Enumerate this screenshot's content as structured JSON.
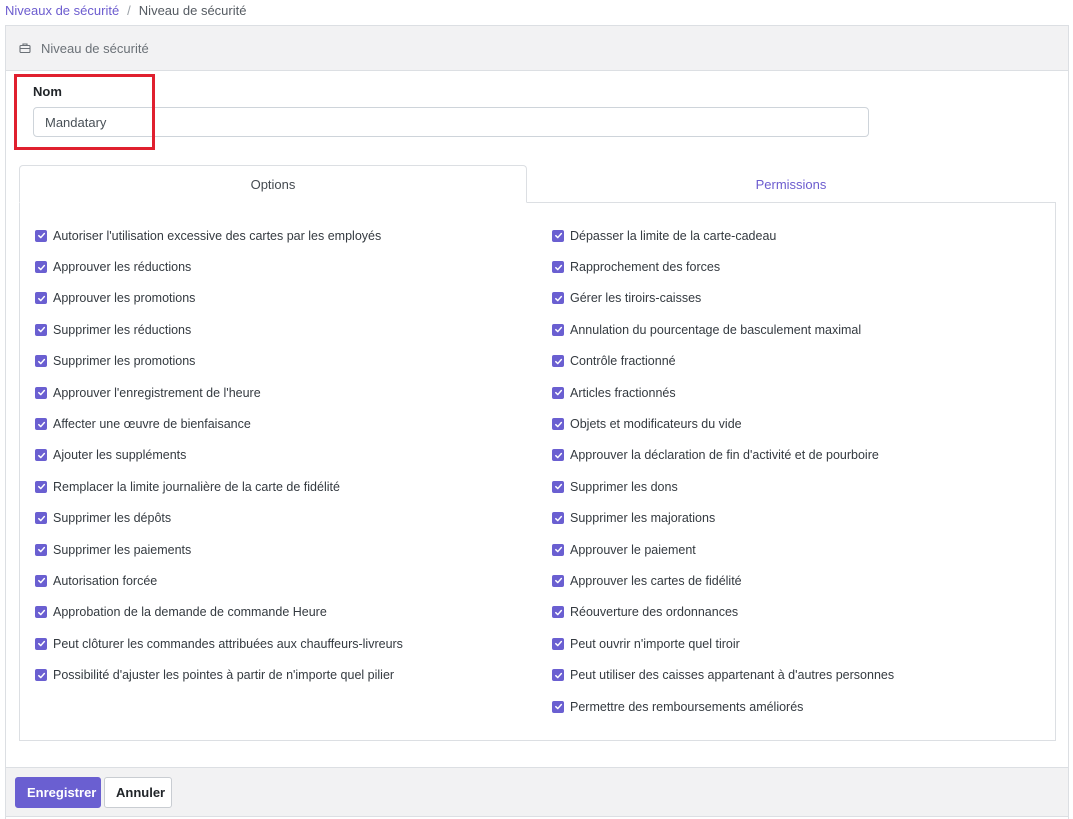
{
  "breadcrumb": {
    "parent": "Niveaux de sécurité",
    "separator": "/",
    "current": "Niveau de sécurité"
  },
  "card": {
    "title": "Niveau de sécurité",
    "icon": "briefcase-icon"
  },
  "form": {
    "name_label": "Nom",
    "name_value": "Mandatary"
  },
  "tabs": {
    "options": "Options",
    "permissions": "Permissions",
    "active": "Options"
  },
  "options_left": [
    {
      "label": "Autoriser l'utilisation excessive des cartes par les employés",
      "checked": true
    },
    {
      "label": "Approuver les réductions",
      "checked": true
    },
    {
      "label": "Approuver les promotions",
      "checked": true
    },
    {
      "label": "Supprimer les réductions",
      "checked": true
    },
    {
      "label": "Supprimer les promotions",
      "checked": true
    },
    {
      "label": "Approuver l'enregistrement de l'heure",
      "checked": true
    },
    {
      "label": "Affecter une œuvre de bienfaisance",
      "checked": true
    },
    {
      "label": "Ajouter les suppléments",
      "checked": true
    },
    {
      "label": "Remplacer la limite journalière de la carte de fidélité",
      "checked": true
    },
    {
      "label": "Supprimer les dépôts",
      "checked": true
    },
    {
      "label": "Supprimer les paiements",
      "checked": true
    },
    {
      "label": "Autorisation forcée",
      "checked": true
    },
    {
      "label": "Approbation de la demande de commande Heure",
      "checked": true
    },
    {
      "label": "Peut clôturer les commandes attribuées aux chauffeurs-livreurs",
      "checked": true
    },
    {
      "label": "Possibilité d'ajuster les pointes à partir de n'importe quel pilier",
      "checked": true
    }
  ],
  "options_right": [
    {
      "label": "Dépasser la limite de la carte-cadeau",
      "checked": true
    },
    {
      "label": "Rapprochement des forces",
      "checked": true
    },
    {
      "label": "Gérer les tiroirs-caisses",
      "checked": true
    },
    {
      "label": "Annulation du pourcentage de basculement maximal",
      "checked": true
    },
    {
      "label": "Contrôle fractionné",
      "checked": true
    },
    {
      "label": "Articles fractionnés",
      "checked": true
    },
    {
      "label": "Objets et modificateurs du vide",
      "checked": true
    },
    {
      "label": "Approuver la déclaration de fin d'activité et de pourboire",
      "checked": true
    },
    {
      "label": "Supprimer les dons",
      "checked": true
    },
    {
      "label": "Supprimer les majorations",
      "checked": true
    },
    {
      "label": "Approuver le paiement",
      "checked": true
    },
    {
      "label": "Approuver les cartes de fidélité",
      "checked": true
    },
    {
      "label": "Réouverture des ordonnances",
      "checked": true
    },
    {
      "label": "Peut ouvrir n'importe quel tiroir",
      "checked": true
    },
    {
      "label": "Peut utiliser des caisses appartenant à d'autres personnes",
      "checked": true
    },
    {
      "label": "Permettre des remboursements améliorés",
      "checked": true
    }
  ],
  "actions": {
    "save": "Enregistrer",
    "cancel": "Annuler"
  },
  "colors": {
    "accent": "#6a5fd1",
    "highlight": "#e0202f"
  }
}
